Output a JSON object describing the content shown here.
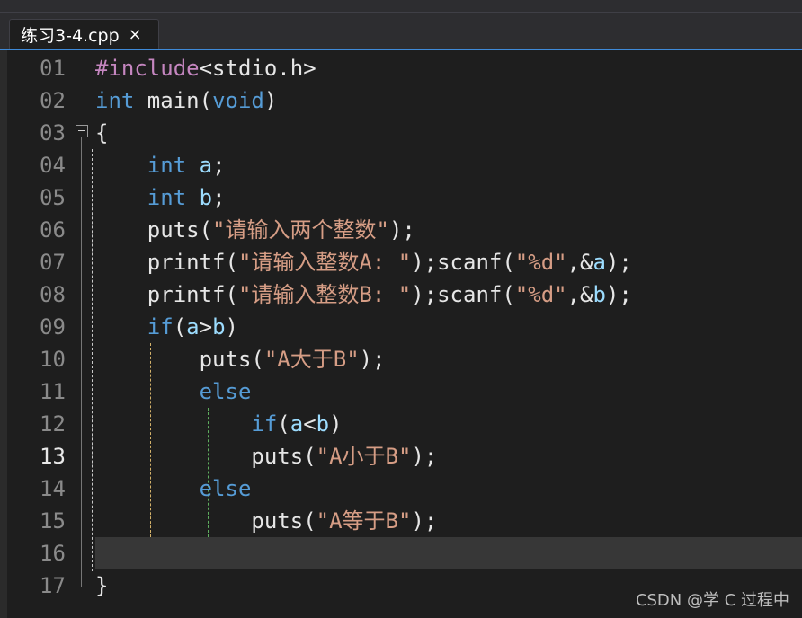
{
  "tab": {
    "title": "练习3-4.cpp",
    "close": "×"
  },
  "editor": {
    "current_line": "13",
    "lines": [
      {
        "num": "01",
        "tokens": [
          {
            "t": "#include",
            "c": "pp"
          },
          {
            "t": "<stdio.h>",
            "c": "fn"
          }
        ]
      },
      {
        "num": "02",
        "tokens": [
          {
            "t": "int",
            "c": "kw"
          },
          {
            "t": " main",
            "c": "fn"
          },
          {
            "t": "(",
            "c": "fn"
          },
          {
            "t": "void",
            "c": "kw"
          },
          {
            "t": ")",
            "c": "fn"
          }
        ]
      },
      {
        "num": "03",
        "tokens": [
          {
            "t": "{",
            "c": "fn"
          }
        ]
      },
      {
        "num": "04",
        "tokens": [
          {
            "t": "    ",
            "c": "fn"
          },
          {
            "t": "int",
            "c": "kw"
          },
          {
            "t": " ",
            "c": "fn"
          },
          {
            "t": "a",
            "c": "var"
          },
          {
            "t": ";",
            "c": "fn"
          }
        ]
      },
      {
        "num": "05",
        "tokens": [
          {
            "t": "    ",
            "c": "fn"
          },
          {
            "t": "int",
            "c": "kw"
          },
          {
            "t": " ",
            "c": "fn"
          },
          {
            "t": "b",
            "c": "var"
          },
          {
            "t": ";",
            "c": "fn"
          }
        ]
      },
      {
        "num": "06",
        "tokens": [
          {
            "t": "    puts(",
            "c": "fn"
          },
          {
            "t": "\"请输入两个整数\"",
            "c": "str"
          },
          {
            "t": ");",
            "c": "fn"
          }
        ]
      },
      {
        "num": "07",
        "tokens": [
          {
            "t": "    printf(",
            "c": "fn"
          },
          {
            "t": "\"请输入整数A: \"",
            "c": "str"
          },
          {
            "t": ");scanf(",
            "c": "fn"
          },
          {
            "t": "\"%d\"",
            "c": "str"
          },
          {
            "t": ",&",
            "c": "fn"
          },
          {
            "t": "a",
            "c": "var"
          },
          {
            "t": ");",
            "c": "fn"
          }
        ]
      },
      {
        "num": "08",
        "tokens": [
          {
            "t": "    printf(",
            "c": "fn"
          },
          {
            "t": "\"请输入整数B: \"",
            "c": "str"
          },
          {
            "t": ");scanf(",
            "c": "fn"
          },
          {
            "t": "\"%d\"",
            "c": "str"
          },
          {
            "t": ",&",
            "c": "fn"
          },
          {
            "t": "b",
            "c": "var"
          },
          {
            "t": ");",
            "c": "fn"
          }
        ]
      },
      {
        "num": "09",
        "tokens": [
          {
            "t": "    ",
            "c": "fn"
          },
          {
            "t": "if",
            "c": "kw"
          },
          {
            "t": "(",
            "c": "fn"
          },
          {
            "t": "a",
            "c": "var"
          },
          {
            "t": ">",
            "c": "fn"
          },
          {
            "t": "b",
            "c": "var"
          },
          {
            "t": ")",
            "c": "fn"
          }
        ]
      },
      {
        "num": "10",
        "tokens": [
          {
            "t": "        puts(",
            "c": "fn"
          },
          {
            "t": "\"A大于B\"",
            "c": "str"
          },
          {
            "t": ");",
            "c": "fn"
          }
        ]
      },
      {
        "num": "11",
        "tokens": [
          {
            "t": "        ",
            "c": "fn"
          },
          {
            "t": "else",
            "c": "kw"
          }
        ]
      },
      {
        "num": "12",
        "tokens": [
          {
            "t": "            ",
            "c": "fn"
          },
          {
            "t": "if",
            "c": "kw"
          },
          {
            "t": "(",
            "c": "fn"
          },
          {
            "t": "a",
            "c": "var"
          },
          {
            "t": "<",
            "c": "fn"
          },
          {
            "t": "b",
            "c": "var"
          },
          {
            "t": ")",
            "c": "fn"
          }
        ]
      },
      {
        "num": "13",
        "tokens": [
          {
            "t": "            puts(",
            "c": "fn"
          },
          {
            "t": "\"A小于B\"",
            "c": "str"
          },
          {
            "t": ");",
            "c": "fn"
          }
        ]
      },
      {
        "num": "14",
        "tokens": [
          {
            "t": "        ",
            "c": "fn"
          },
          {
            "t": "else",
            "c": "kw"
          }
        ]
      },
      {
        "num": "15",
        "tokens": [
          {
            "t": "            puts(",
            "c": "fn"
          },
          {
            "t": "\"A等于B\"",
            "c": "str"
          },
          {
            "t": ");",
            "c": "fn"
          }
        ]
      },
      {
        "num": "16",
        "tokens": [
          {
            "t": "",
            "c": "fn"
          }
        ]
      },
      {
        "num": "17",
        "tokens": [
          {
            "t": "}",
            "c": "fn"
          }
        ]
      }
    ]
  },
  "watermark": "CSDN @学 C 过程中",
  "colors": {
    "keyword": "#569cd6",
    "string": "#d69d85",
    "preprocessor": "#c586c0",
    "variable": "#9cdcfe",
    "text": "#e6e6e6",
    "guide_yellow": "#d4b26a",
    "guide_green": "#5fae5f"
  }
}
